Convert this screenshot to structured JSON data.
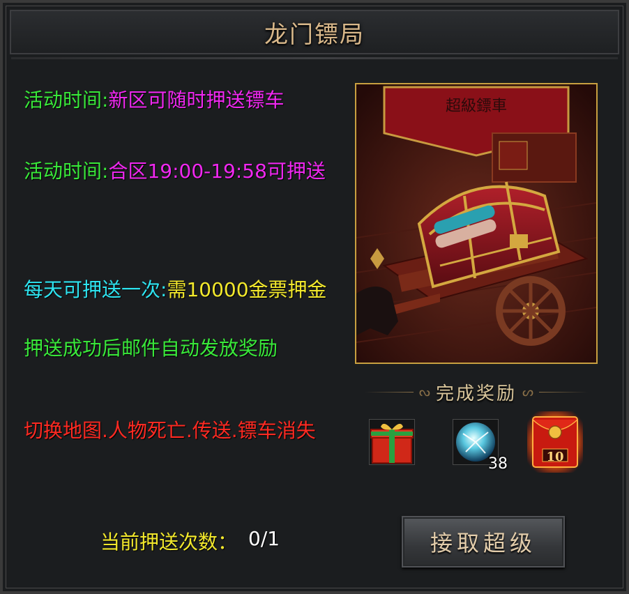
{
  "window": {
    "title": "龙门镖局"
  },
  "info_lines": [
    {
      "label": "活动时间:",
      "value": "新区可随时押送镖车"
    },
    {
      "label": "活动时间:",
      "value": "合区19:00-19:58可押送"
    },
    {
      "label": "每天可押送一次:",
      "value": "需10000金票押金"
    },
    {
      "text": "押送成功后邮件自动发放奖励"
    },
    {
      "text": "切换地图.人物死亡.传送.镖车消失"
    }
  ],
  "banner_text": "超級鏢車",
  "rewards": {
    "header": "完成奖励",
    "items": [
      {
        "icon": "gift-box-icon",
        "quantity": ""
      },
      {
        "icon": "energy-orb-icon",
        "quantity": "38"
      },
      {
        "icon": "red-envelope-icon",
        "quantity": "10"
      }
    ]
  },
  "status": {
    "label": "当前押送次数：",
    "value": "0/1"
  },
  "actions": {
    "accept_label": "接取超级"
  },
  "colors": {
    "label_green": "#39e83a",
    "value_magenta": "#f028f0",
    "label_cyan": "#2ee4f0",
    "value_yellow": "#f2e82c",
    "warning_red": "#ff2a22",
    "title_gold": "#d9b88a"
  }
}
